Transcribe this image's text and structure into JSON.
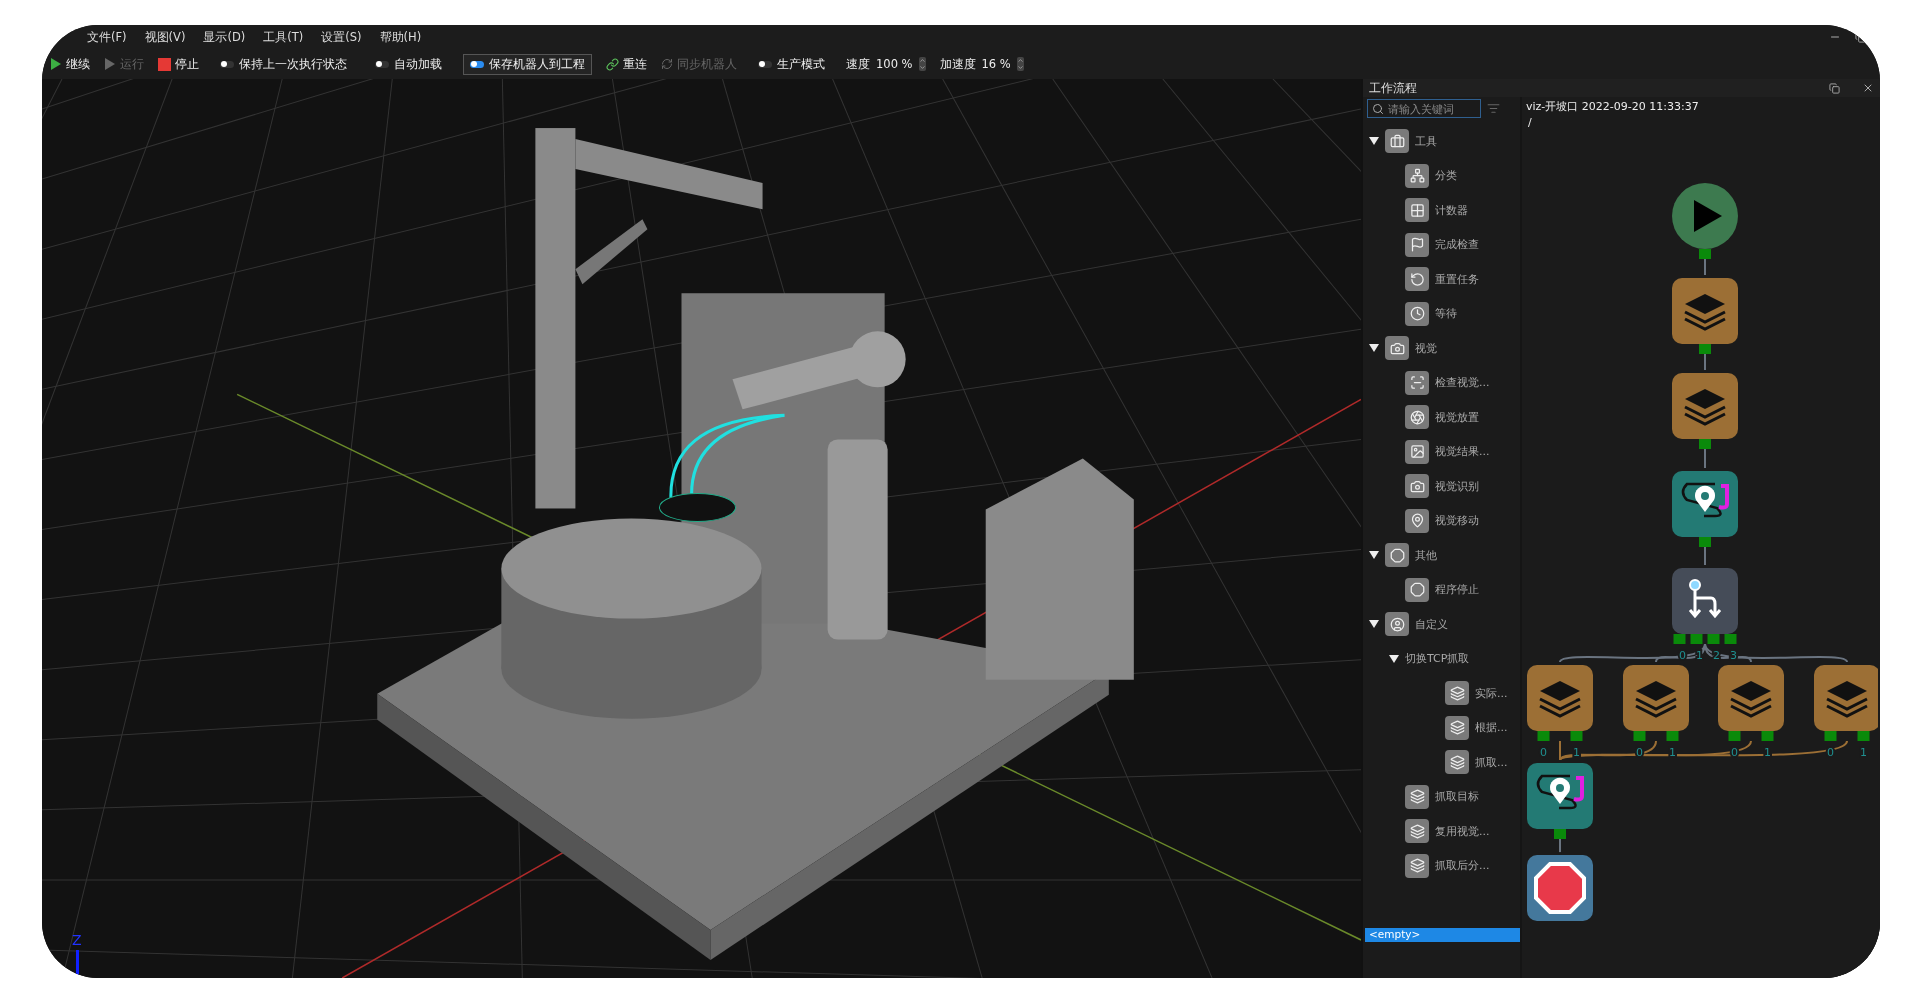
{
  "menu": [
    "文件(F)",
    "视图(V)",
    "显示(D)",
    "工具(T)",
    "设置(S)",
    "帮助(H)"
  ],
  "toolbar": [
    {
      "kind": "play",
      "label": "继续",
      "disabled": false
    },
    {
      "kind": "play",
      "label": "运行",
      "disabled": true
    },
    {
      "kind": "stop",
      "label": "停止",
      "disabled": false
    },
    {
      "kind": "toggle",
      "label": "保持上一次执行状态",
      "on": false
    },
    {
      "kind": "toggle",
      "label": "自动加载",
      "on": false
    },
    {
      "kind": "toggle",
      "label": "保存机器人到工程",
      "on": true
    },
    {
      "kind": "link",
      "label": "重连",
      "disabled": false
    },
    {
      "kind": "sync",
      "label": "同步机器人",
      "disabled": true
    },
    {
      "kind": "toggle",
      "label": "生产模式",
      "on": false
    },
    {
      "kind": "spin",
      "label": "速度",
      "value": "100 %"
    },
    {
      "kind": "spin",
      "label": "加速度",
      "value": "16 %"
    }
  ],
  "viewport": {
    "axis_label": "Z"
  },
  "panel": {
    "title": "工作流程",
    "search": {
      "placeholder": "请输入关键词"
    },
    "tree": [
      {
        "label": "工具",
        "expanded": true,
        "children": [
          {
            "label": "分类"
          },
          {
            "label": "计数器"
          },
          {
            "label": "完成检查"
          },
          {
            "label": "重置任务"
          },
          {
            "label": "等待"
          }
        ]
      },
      {
        "label": "视觉",
        "expanded": true,
        "children": [
          {
            "label": "检查视觉..."
          },
          {
            "label": "视觉放置"
          },
          {
            "label": "视觉结果..."
          },
          {
            "label": "视觉识别"
          },
          {
            "label": "视觉移动"
          }
        ]
      },
      {
        "label": "其他",
        "expanded": true,
        "children": [
          {
            "label": "程序停止"
          }
        ]
      },
      {
        "label": "自定义",
        "expanded": true,
        "children": [
          {
            "label": "切换TCP抓取",
            "folder": true,
            "expanded": true,
            "children": [
              {
                "label": "实际..."
              },
              {
                "label": "根据..."
              },
              {
                "label": "抓取..."
              }
            ]
          },
          {
            "label": "抓取目标"
          },
          {
            "label": "复用视觉..."
          },
          {
            "label": "抓取后分..."
          }
        ]
      }
    ],
    "footer": "<empty>",
    "flow": {
      "title": "viz-开坡口 2022-09-20 11:33:37",
      "path": "/",
      "nodes": [
        {
          "kind": "start"
        },
        {
          "kind": "layers"
        },
        {
          "kind": "layers"
        },
        {
          "kind": "move"
        },
        {
          "kind": "branch",
          "ports": [
            "0",
            "1",
            "2",
            "3"
          ]
        },
        {
          "kind": "layers",
          "ports": [
            "0",
            "1"
          ]
        },
        {
          "kind": "layers",
          "ports": [
            "0",
            "1"
          ]
        },
        {
          "kind": "layers",
          "ports": [
            "0",
            "1"
          ]
        },
        {
          "kind": "layers",
          "ports": [
            "0",
            "1"
          ]
        },
        {
          "kind": "move"
        },
        {
          "kind": "stop"
        }
      ]
    }
  }
}
